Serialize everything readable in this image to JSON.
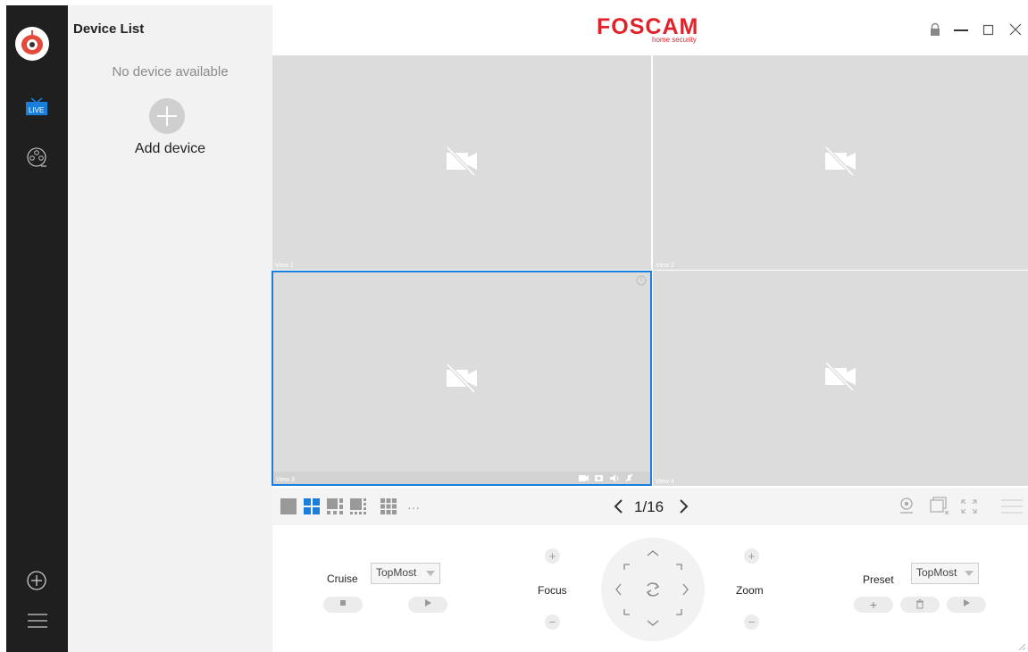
{
  "app": {
    "brand": "FOSCAM",
    "brand_sub": "home security"
  },
  "nav": {
    "live_label": "LIVE"
  },
  "device_list": {
    "title": "Device List",
    "empty_text": "No device available",
    "add_label": "Add device"
  },
  "views": [
    {
      "label": "View 1"
    },
    {
      "label": "View 2"
    },
    {
      "label": "View 3"
    },
    {
      "label": "View 4"
    }
  ],
  "toolbar": {
    "pager": "1/16",
    "more": "···"
  },
  "ptz": {
    "cruise_label": "Cruise",
    "cruise_select": "TopMost",
    "focus_label": "Focus",
    "zoom_label": "Zoom",
    "preset_label": "Preset",
    "preset_select": "TopMost"
  },
  "colors": {
    "accent": "#1a7fdc",
    "brand": "#e0222a",
    "nav_bg": "#1f1f1f"
  }
}
